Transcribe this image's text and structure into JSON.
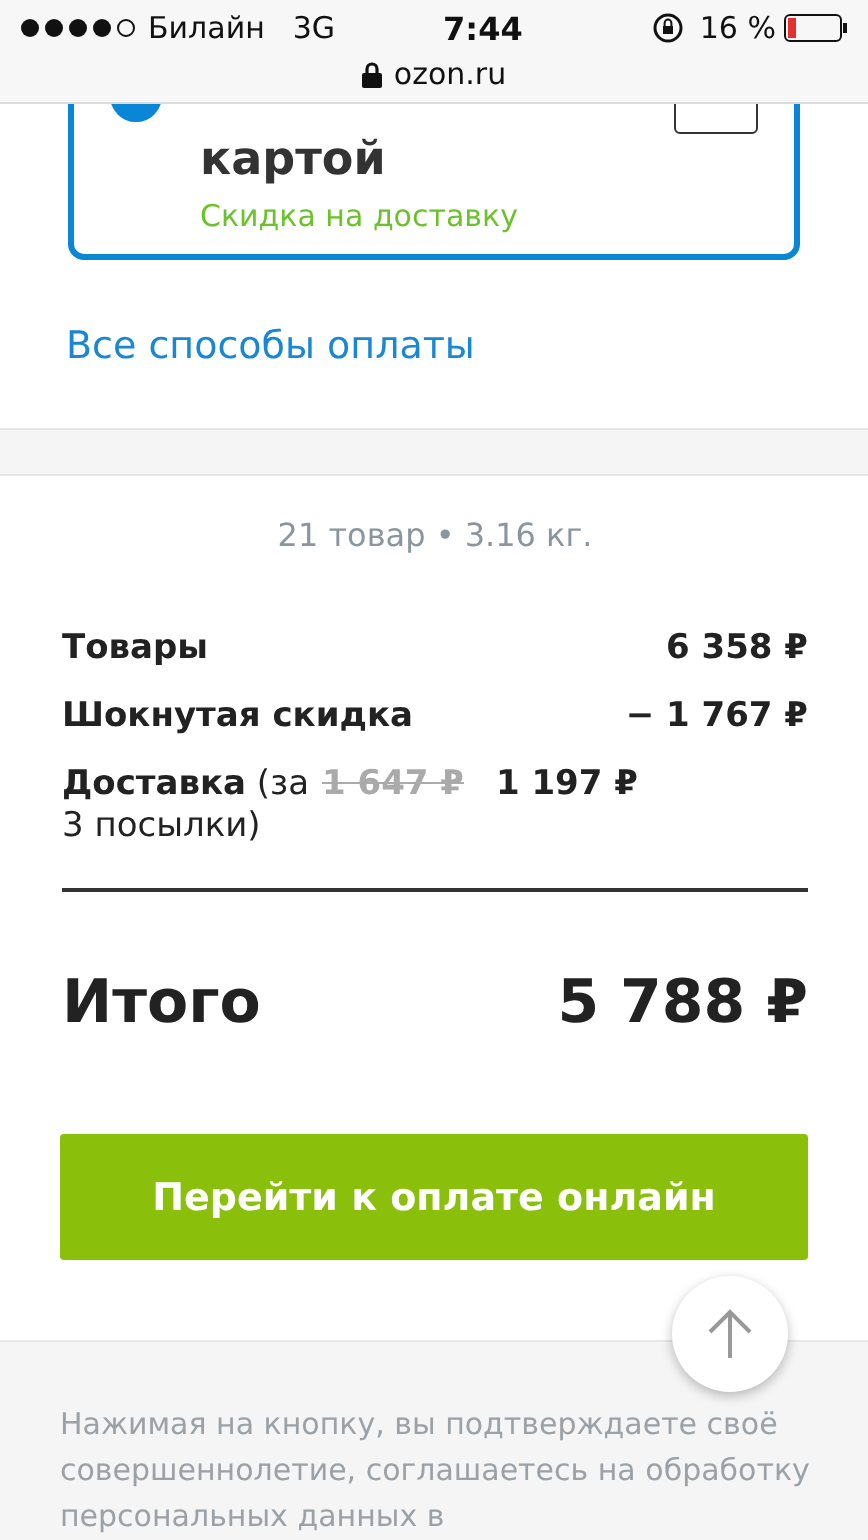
{
  "status_bar": {
    "carrier": "Билайн",
    "network": "3G",
    "time": "7:44",
    "battery": "16 %",
    "url": "ozon.ru"
  },
  "payment_card": {
    "selected": true,
    "title": "картой",
    "note": "Скидка на доставку"
  },
  "all_payment_link": "Все способы оплаты",
  "summary": {
    "meta": "21 товар • 3.16 кг.",
    "rows": [
      {
        "label": "Товары",
        "value": "6 358 ₽"
      },
      {
        "label": "Шокнутая скидка",
        "value": "− 1 767 ₽"
      },
      {
        "label": "**Доставка** (за 3 посылки)",
        "old_value": "1 647 ₽",
        "value": "1 197 ₽"
      }
    ],
    "total_label": "Итого",
    "total_value": "5 788 ₽"
  },
  "pay_button": "Перейти к оплате онлайн",
  "disclaimer": "Нажимая на кнопку, вы подтверждаете своё совершеннолетие, соглашаетесь на обработку персональных данных в"
}
